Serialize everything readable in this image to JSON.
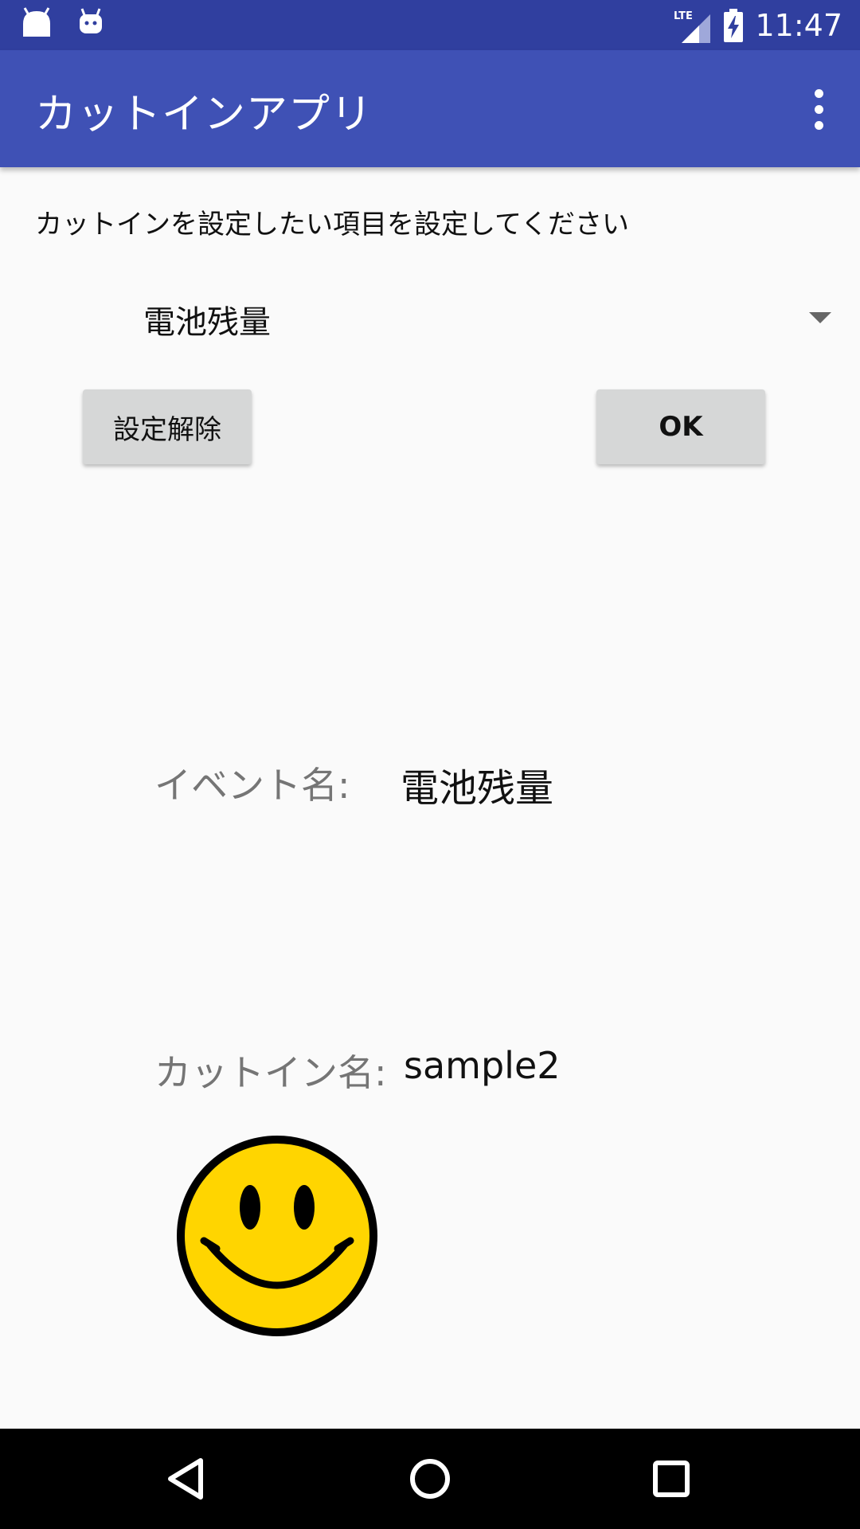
{
  "status_bar": {
    "time": "11:47",
    "network": "LTE",
    "left_icons": [
      "android-icon",
      "android-debug-icon"
    ],
    "right_icons": [
      "lte-signal-icon",
      "battery-charging-icon"
    ]
  },
  "app_bar": {
    "title": "カットインアプリ",
    "menu_icon": "overflow-menu-icon"
  },
  "main": {
    "instruction": "カットインを設定したい項目を設定してください",
    "spinner": {
      "selected": "電池残量"
    },
    "buttons": {
      "clear_label": "設定解除",
      "ok_label": "OK"
    },
    "event": {
      "label": "イベント名:",
      "value": "電池残量"
    },
    "cutin": {
      "label": "カットイン名:",
      "value": "sample2"
    },
    "image": {
      "icon": "smiley-face-icon",
      "face_color": "#ffd500",
      "outline_color": "#000000"
    }
  },
  "nav_bar": {
    "icons": [
      "back-icon",
      "home-icon",
      "recent-apps-icon"
    ]
  },
  "colors": {
    "status_bar": "#303f9f",
    "app_bar": "#3f51b5",
    "background": "#fafafa",
    "button": "#d6d7d7"
  }
}
